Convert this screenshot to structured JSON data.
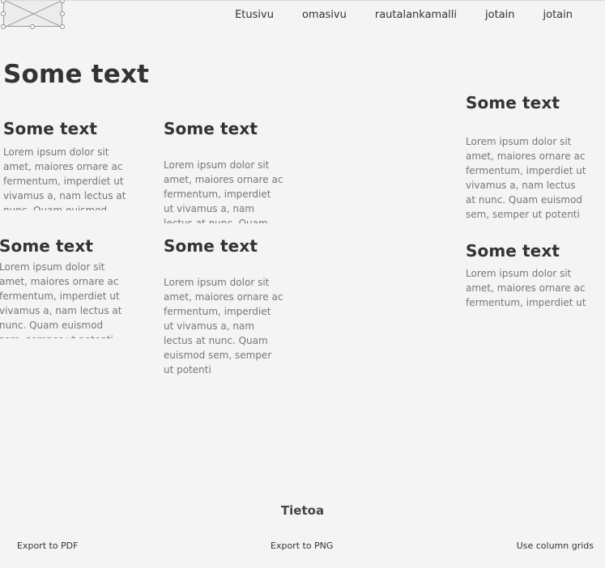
{
  "nav": {
    "items": [
      "Etusivu",
      "omasivu",
      "rautalankamalli",
      "jotain",
      "jotain"
    ]
  },
  "page_title": "Some text",
  "blocks": [
    {
      "heading": "Some text",
      "text": "Lorem ipsum dolor sit amet, maiores ornare ac fermentum, imperdiet ut vivamus a, nam lectus at nunc. Quam euismod sem, semper ut potenti"
    },
    {
      "heading": "Some text",
      "text": "Lorem ipsum dolor sit amet, maiores ornare ac fermentum, imperdiet ut vivamus a, nam lectus at nunc. Quam euismod sem, semper ut potenti"
    },
    {
      "heading": "Some text",
      "text": "Lorem ipsum dolor sit amet, maiores ornare ac fermentum, imperdiet ut vivamus a, nam lectus at nunc. Quam euismod sem, semper ut potenti"
    },
    {
      "heading": "Some text",
      "text": "Lorem ipsum dolor sit amet, maiores ornare ac fermentum, imperdiet ut vivamus a, nam lectus at nunc. Quam euismod sem, semper ut potenti"
    },
    {
      "heading": "Some text",
      "text": "Lorem ipsum dolor sit amet, maiores ornare ac fermentum, imperdiet ut vivamus a, nam lectus at nunc. Quam euismod sem, semper ut potenti"
    },
    {
      "heading": "Some text",
      "text": "Lorem ipsum dolor sit amet, maiores ornare ac fermentum, imperdiet ut"
    }
  ],
  "footer": {
    "title": "Tietoa",
    "export_pdf": "Export to PDF",
    "export_png": "Export to PNG",
    "column_grids": "Use column grids"
  },
  "icons": {
    "image_placeholder": "image-placeholder-icon"
  }
}
